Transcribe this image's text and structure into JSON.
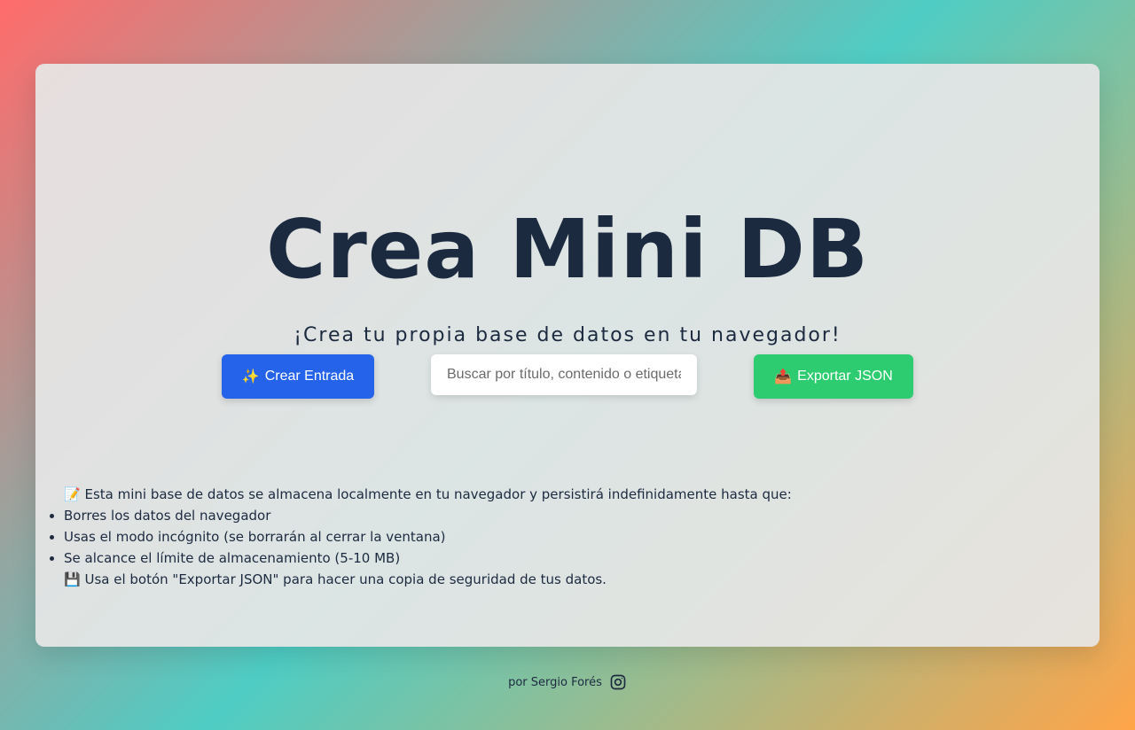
{
  "header": {
    "title": "Crea Mini DB",
    "subtitle": "¡Crea tu propia base de datos en tu navegador!"
  },
  "toolbar": {
    "create_icon": "✨",
    "create_label": "Crear Entrada",
    "search_placeholder": "Buscar por título, contenido o etiquetas",
    "export_icon": "📤",
    "export_label": "Exportar JSON"
  },
  "info": {
    "intro_icon": "📝",
    "intro": "Esta mini base de datos se almacena localmente en tu navegador y persistirá indefinidamente hasta que:",
    "items": [
      "Borres los datos del navegador",
      "Usas el modo incógnito (se borrarán al cerrar la ventana)",
      "Se alcance el límite de almacenamiento (5-10 MB)"
    ],
    "tip_icon": "💾",
    "tip": "Usa el botón \"Exportar JSON\" para hacer una copia de seguridad de tus datos."
  },
  "footer": {
    "credit": "por Sergio Forés",
    "icon": "instagram-icon"
  },
  "colors": {
    "primary": "#2563eb",
    "export": "#2ecc71",
    "text": "#1c2a40"
  }
}
